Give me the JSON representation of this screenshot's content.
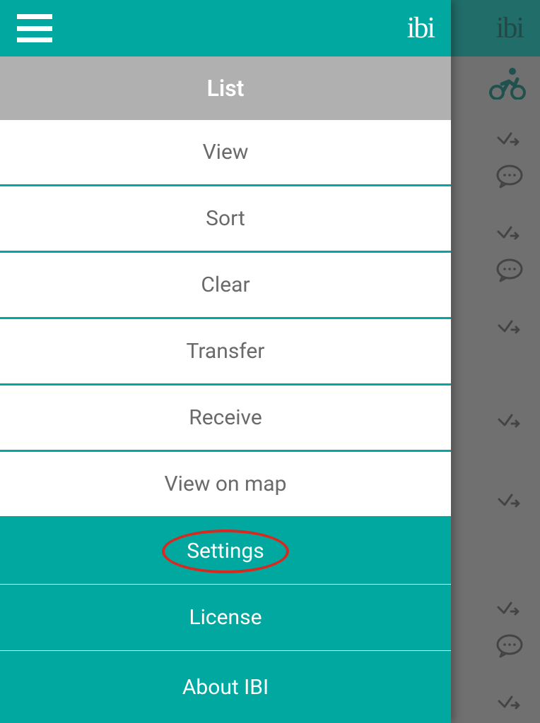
{
  "header": {
    "logo_text": "ibi"
  },
  "background": {
    "logo_text": "ibi"
  },
  "menu": {
    "section_label": "List",
    "items": [
      {
        "label": "View",
        "style": "white"
      },
      {
        "label": "Sort",
        "style": "white"
      },
      {
        "label": "Clear",
        "style": "white"
      },
      {
        "label": "Transfer",
        "style": "white"
      },
      {
        "label": "Receive",
        "style": "white"
      },
      {
        "label": "View on map",
        "style": "white"
      },
      {
        "label": "Settings",
        "style": "teal",
        "highlighted": true
      },
      {
        "label": "License",
        "style": "teal"
      },
      {
        "label": "About IBI",
        "style": "teal"
      }
    ]
  },
  "colors": {
    "teal": "#00a8a0",
    "highlight_red": "#d8281f",
    "grey_header": "#b0b0b0",
    "text_grey": "#6a6a6a"
  }
}
